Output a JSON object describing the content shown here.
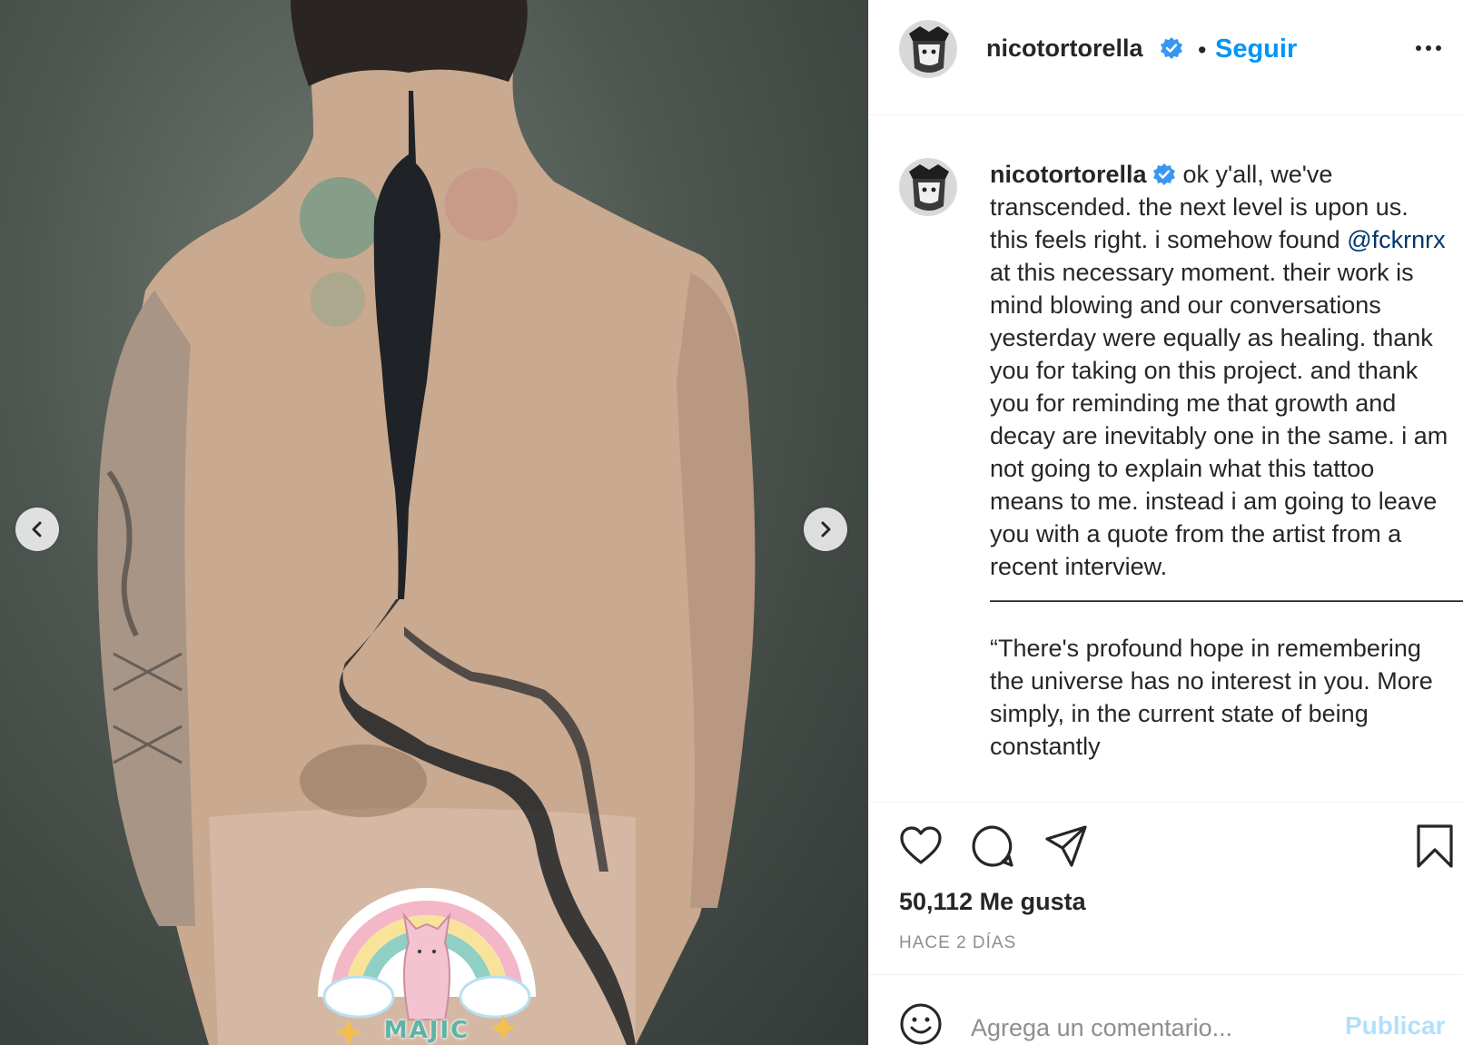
{
  "media": {
    "sticker_text": "MAJIC"
  },
  "post": {
    "username": "nicotortorella",
    "follow_dot": "•",
    "follow_label": "Seguir",
    "caption": {
      "before_mention": "ok y'all, we've transcended. the next level is upon us. this feels right. i somehow found",
      "mention": "@fckrnrx",
      "after_mention": "at this necessary moment. their work is mind blowing and our conversations yesterday were equally as healing. thank you for taking on this project. and thank you for reminding me that growth and decay are inevitably one in the same. i am not going to explain what this tattoo means to me. instead i am going to leave you with a quote from the artist from a recent interview.",
      "divider": "——————————————————————",
      "quote": "“There's profound hope in remembering the universe has no interest in you. More simply, in the current state of being constantly"
    },
    "likes": "50,112 Me gusta",
    "timestamp": "HACE 2 DÍAS"
  },
  "comment": {
    "placeholder": "Agrega un comentario...",
    "publish_label": "Publicar"
  },
  "colors": {
    "accent": "#0095f6",
    "verified": "#3897f0",
    "mention": "#00376b",
    "publish_disabled": "#b2dffc"
  }
}
